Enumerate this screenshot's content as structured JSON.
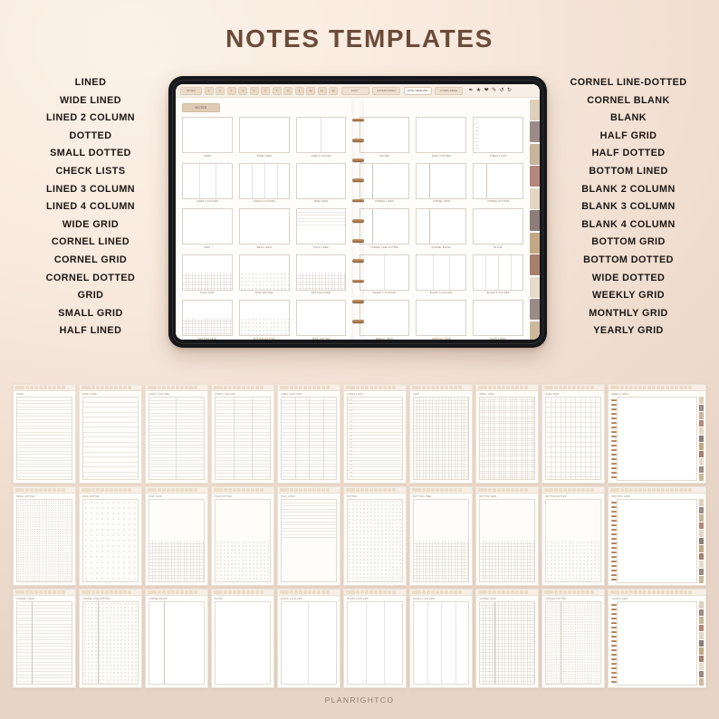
{
  "page": {
    "title": "NOTES TEMPLATES",
    "footer": "PLANRIGHTCO",
    "bg_light": "#fbf1e7",
    "bg_dark": "#e3d3c5",
    "title_color": "#6b4b3a"
  },
  "left_list": [
    "LINED",
    "WIDE LINED",
    "LINED 2 COLUMN",
    "DOTTED",
    "SMALL DOTTED",
    "CHECK LISTS",
    "LINED 3 COLUMN",
    "LINED 4 COLUMN",
    "WIDE GRID",
    "CORNEL LINED",
    "CORNEL GRID",
    "CORNEL DOTTED",
    "GRID",
    "SMALL GRID",
    "HALF LINED"
  ],
  "right_list": [
    "CORNEL LINE-DOTTED",
    "CORNEL BLANK",
    "BLANK",
    "HALF GRID",
    "HALF DOTTED",
    "BOTTOM LINED",
    "BLANK 2 COLUMN",
    "BLANK 3 COLUMN",
    "BLANK 4 COLUMN",
    "BOTTOM GRID",
    "BOTTOM DOTTED",
    "WIDE DOTTED",
    "WEEKLY GRID",
    "MONTHLY GRID",
    "YEARLY GRID"
  ],
  "tablet": {
    "toolbar": {
      "home_label": "NOTES",
      "numbers": [
        "1",
        "2",
        "3",
        "4",
        "5",
        "6",
        "7",
        "8",
        "9",
        "10",
        "11",
        "12"
      ],
      "tabs": [
        {
          "label": "DAILY",
          "active": false
        },
        {
          "label": "COVERS INDEX",
          "active": false
        },
        {
          "label": "NOTE TEMPLATE",
          "active": true
        },
        {
          "label": "HYPERLINKED",
          "active": false
        }
      ],
      "tools": [
        "pen-icon",
        "star-icon",
        "heart-icon",
        "eraser-icon",
        "undo-icon",
        "redo-icon"
      ]
    },
    "section_tab": "NOTES",
    "thumbnails_left": [
      {
        "caption": "LINED",
        "pattern": "p-lined"
      },
      {
        "caption": "WIDE LINED",
        "pattern": "p-wide"
      },
      {
        "caption": "LINED 2 COLUMN",
        "pattern": "p-lined p-cols2"
      },
      {
        "caption": "LINED 3 COLUMN",
        "pattern": "p-lined p-cols3"
      },
      {
        "caption": "LINED 4 COLUMN",
        "pattern": "p-lined p-cols4"
      },
      {
        "caption": "WIDE GRID",
        "pattern": "p-wgrid"
      },
      {
        "caption": "GRID",
        "pattern": "p-grid"
      },
      {
        "caption": "SMALL GRID",
        "pattern": "p-sgrid"
      },
      {
        "caption": "HALF LINED",
        "pattern": "p-halftop"
      },
      {
        "caption": "HALF GRID",
        "pattern": "p-halfbot"
      },
      {
        "caption": "HALF DOTTED",
        "pattern": "p-bdot"
      },
      {
        "caption": "BOTTOM LINED",
        "pattern": "p-halfbot"
      },
      {
        "caption": "BOTTOM GRID",
        "pattern": "p-halfbot"
      },
      {
        "caption": "BOTTOM DOTTED",
        "pattern": "p-bdot"
      },
      {
        "caption": "WIDE DOTTED",
        "pattern": "p-wdot"
      }
    ],
    "thumbnails_right": [
      {
        "caption": "DOTTED",
        "pattern": "p-dot"
      },
      {
        "caption": "SMALL DOTTED",
        "pattern": "p-sdot"
      },
      {
        "caption": "CHECK LISTS",
        "pattern": "p-lined p-check"
      },
      {
        "caption": "CORNEL LINED",
        "pattern": "p-lined p-corner"
      },
      {
        "caption": "CORNEL GRID",
        "pattern": "p-grid p-corner"
      },
      {
        "caption": "CORNEL DOTTED",
        "pattern": "p-dot p-corner"
      },
      {
        "caption": "CORNEL LINE-DOTTED",
        "pattern": "p-sdot p-corner"
      },
      {
        "caption": "CORNEL BLANK",
        "pattern": "p-blank p-corner"
      },
      {
        "caption": "BLANK",
        "pattern": "p-blank"
      },
      {
        "caption": "BLANK 2 COLUMN",
        "pattern": "p-blank p-cols2"
      },
      {
        "caption": "BLANK 3 COLUMN",
        "pattern": "p-blank p-cols3"
      },
      {
        "caption": "BLANK 4 COLUMN",
        "pattern": "p-blank p-cols4"
      },
      {
        "caption": "WEEKLY GRID",
        "pattern": "p-weekly"
      },
      {
        "caption": "MONTHLY GRID",
        "pattern": "p-monthly"
      },
      {
        "caption": "YEARLY GRID",
        "pattern": "p-yearly"
      }
    ],
    "side_tab_colors": [
      "#ded0b9",
      "#9c8a86",
      "#c7b49a",
      "#b5877a",
      "#e2d6c2",
      "#8d7d79",
      "#c2a884",
      "#a87f6e",
      "#e6dcca",
      "#9a8c84",
      "#cdb89b"
    ]
  },
  "mosaic": [
    {
      "label": "LINED",
      "pattern": "p-lined"
    },
    {
      "label": "WIDE LINED",
      "pattern": "p-wide"
    },
    {
      "label": "LINED 2 COLUMN",
      "pattern": "p-lined p-cols2"
    },
    {
      "label": "LINED 3 COLUMN",
      "pattern": "p-lined p-cols3"
    },
    {
      "label": "LINED 4 COLUMN",
      "pattern": "p-lined p-cols4"
    },
    {
      "label": "CHECK LISTS",
      "pattern": "p-lined p-check"
    },
    {
      "label": "GRID",
      "pattern": "p-grid"
    },
    {
      "label": "SMALL GRID",
      "pattern": "p-sgrid"
    },
    {
      "label": "WIDE GRID",
      "pattern": "p-wgrid"
    },
    {
      "label": "WEEKLY GRID",
      "pattern": "p-sgrid",
      "spread": true
    },
    {
      "label": "SMALL DOTTED",
      "pattern": "p-sdot"
    },
    {
      "label": "WIDE DOTTED",
      "pattern": "p-wdot"
    },
    {
      "label": "HALF GRID",
      "pattern": "p-halfbot"
    },
    {
      "label": "HALF DOTTED",
      "pattern": "p-bdot"
    },
    {
      "label": "HALF LINED",
      "pattern": "p-halftop"
    },
    {
      "label": "DOTTED",
      "pattern": "p-dot"
    },
    {
      "label": "BOTTOM LINED",
      "pattern": "p-halfbot"
    },
    {
      "label": "BOTTOM GRID",
      "pattern": "p-halfbot"
    },
    {
      "label": "BOTTOM DOTTED",
      "pattern": "p-bdot"
    },
    {
      "label": "MONTHLY GRID",
      "pattern": "p-lined",
      "spread": true
    },
    {
      "label": "CORNEL LINED",
      "pattern": "p-lined p-corner"
    },
    {
      "label": "CORNEL LINE-DOTTED",
      "pattern": "p-dot p-corner"
    },
    {
      "label": "CORNEL BLANK",
      "pattern": "p-blank p-corner"
    },
    {
      "label": "BLANK",
      "pattern": "p-blank"
    },
    {
      "label": "BLANK 2 COLUMN",
      "pattern": "p-blank p-cols2"
    },
    {
      "label": "BLANK 3 COLUMN",
      "pattern": "p-blank p-cols3"
    },
    {
      "label": "BLANK 4 COLUMN",
      "pattern": "p-blank p-cols4"
    },
    {
      "label": "CORNEL GRID",
      "pattern": "p-grid p-corner"
    },
    {
      "label": "CORNEL DOTTED",
      "pattern": "p-sdot p-corner"
    },
    {
      "label": "YEARLY GRID",
      "pattern": "p-yearly",
      "spread": true
    }
  ]
}
